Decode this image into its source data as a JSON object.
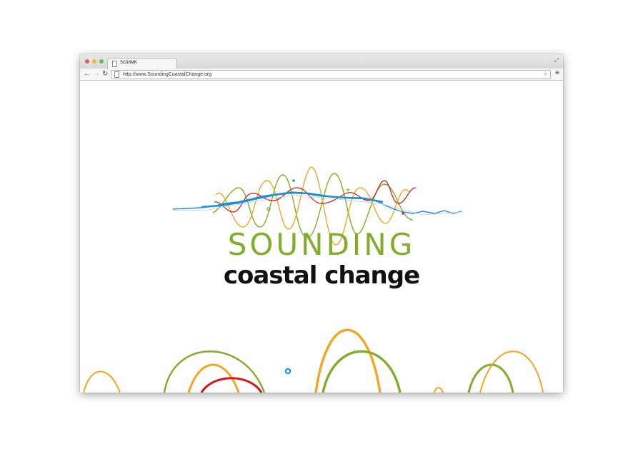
{
  "browser": {
    "tab_title": "SCIMMK",
    "url": "http://www.SoundingCoastalChange.org",
    "icons": {
      "back": "back-arrow-icon",
      "forward": "forward-arrow-icon",
      "reload": "reload-icon",
      "bookmark": "star-icon",
      "menu": "hamburger-menu-icon",
      "fullscreen": "expand-icon"
    }
  },
  "logo": {
    "line1": "SOUNDING",
    "line2": "coastal change"
  },
  "colors": {
    "green": "#7fae2a",
    "orange": "#f2a623",
    "red": "#d4141b",
    "blue": "#1b8fd6",
    "text_dark": "#111111"
  }
}
